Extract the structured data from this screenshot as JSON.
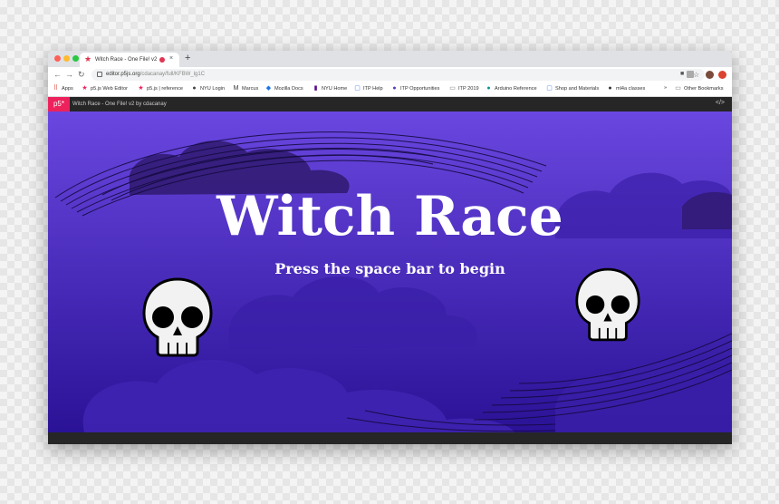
{
  "browser": {
    "tab_title": "Witch Race - One File! v2",
    "new_tab_label": "+",
    "close_tab_label": "×",
    "url_host": "editor.p5js.org",
    "url_path": "/cdacanay/full/KFBW_lg1C"
  },
  "bookmarks": [
    {
      "label": "Apps",
      "icon": "apps-grid-icon",
      "color": "#d93025"
    },
    {
      "label": "p5.js Web Editor",
      "icon": "p5-star-icon",
      "color": "#ed225d"
    },
    {
      "label": "p5.js | reference",
      "icon": "p5-star-icon",
      "color": "#ed225d"
    },
    {
      "label": "NYU Login",
      "icon": "globe-icon",
      "color": "#444444"
    },
    {
      "label": "Marcus",
      "icon": "medium-m-icon",
      "color": "#333333"
    },
    {
      "label": "Mozilla Docs",
      "icon": "mdn-icon",
      "color": "#1a73e8"
    },
    {
      "label": "NYU Home",
      "icon": "nyu-torch-icon",
      "color": "#57068c"
    },
    {
      "label": "ITP Help",
      "icon": "page-icon",
      "color": "#4285f4"
    },
    {
      "label": "ITP Opportunities",
      "icon": "circle-icon",
      "color": "#5b3db3"
    },
    {
      "label": "ITP 2019",
      "icon": "folder-icon",
      "color": "#777777"
    },
    {
      "label": "Arduino Reference",
      "icon": "globe-icon",
      "color": "#00979c"
    },
    {
      "label": "Shop and Materials",
      "icon": "page-icon",
      "color": "#4285f4"
    },
    {
      "label": "ml4a classes",
      "icon": "github-icon",
      "color": "#333333"
    }
  ],
  "other_bookmarks": {
    "label": "Other Bookmarks",
    "icon": "folder-icon"
  },
  "bookmarks_overflow": "»",
  "p5_editor": {
    "logo": "p5*",
    "sketch_title": "Witch Race - One File! v2",
    "author": "by cdacanay",
    "code_icon_glyph": "</>"
  },
  "game": {
    "title": "Witch Race",
    "prompt": "Press the space bar to begin"
  },
  "colors": {
    "sky_top": "#6a47e0",
    "sky_bottom": "#2a1296",
    "cloud": "#3a1fa8",
    "cloud_dark": "#2f1a6e",
    "p5_pink": "#ed225d",
    "text": "#ffffff"
  }
}
